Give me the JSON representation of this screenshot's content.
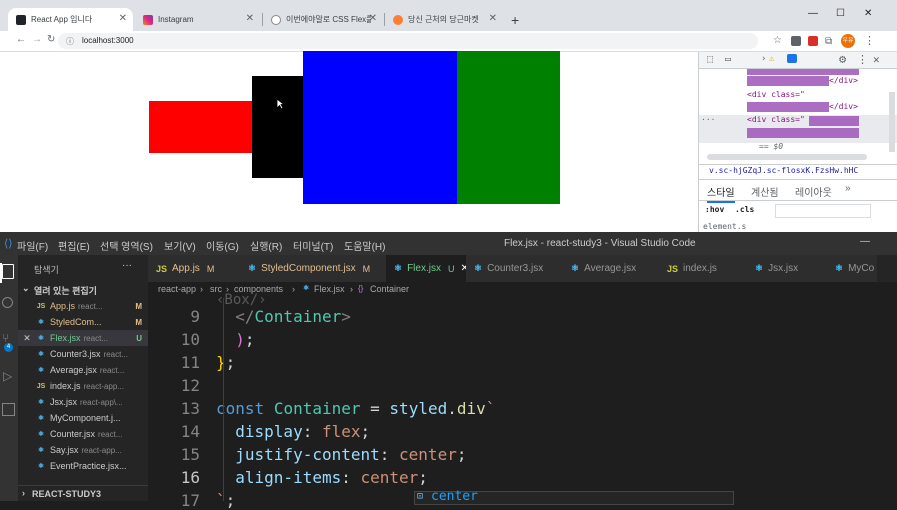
{
  "browser": {
    "tabs": [
      {
        "title": "React App 입니다",
        "active": true
      },
      {
        "title": "Instagram",
        "active": false
      },
      {
        "title": "이번에야말로 CSS Flex를 익혀보자",
        "active": false
      },
      {
        "title": "당신 근처의 당근마켓",
        "active": false
      }
    ],
    "new_tab": "+",
    "address": "localhost:3000",
    "profile": "우유"
  },
  "page": {
    "boxes": [
      {
        "color": "#ff0000"
      },
      {
        "color": "#000000"
      },
      {
        "color": "#0000ff"
      },
      {
        "color": "#008000"
      }
    ]
  },
  "devtools": {
    "lines": [
      "</div>",
      "<div class=\"",
      "</div>",
      "<div class=\"",
      "== $0"
    ],
    "selector": "v.sc-hjGZqJ.sc-flosxK.FzsHw.hHC",
    "tabs": [
      "스타일",
      "계산됨",
      "레이아웃",
      "»"
    ],
    "filter_hov": ":hov",
    "filter_cls": ".cls",
    "element_label": "element.s"
  },
  "vscode": {
    "menu": [
      "파일(F)",
      "편집(E)",
      "선택 영역(S)",
      "보기(V)",
      "이동(G)",
      "실행(R)",
      "터미널(T)",
      "도움말(H)"
    ],
    "title": "Flex.jsx - react-study3 - Visual Studio Code",
    "explorer_title": "탐색기",
    "open_editors_title": "열려 있는 편집기",
    "open_editors": [
      {
        "name": "App.js",
        "path": "react...",
        "status": "M",
        "active": false
      },
      {
        "name": "StyledCom...",
        "path": "",
        "status": "M",
        "active": false
      },
      {
        "name": "Flex.jsx",
        "path": "react...",
        "status": "U",
        "active": true
      },
      {
        "name": "Counter3.jsx",
        "path": "react...",
        "status": "",
        "active": false
      },
      {
        "name": "Average.jsx",
        "path": "react...",
        "status": "",
        "active": false
      },
      {
        "name": "index.js",
        "path": "react-app...",
        "status": "",
        "active": false
      },
      {
        "name": "Jsx.jsx",
        "path": "react-app\\...",
        "status": "",
        "active": false
      },
      {
        "name": "MyComponent.j...",
        "path": "",
        "status": "",
        "active": false
      },
      {
        "name": "Counter.jsx",
        "path": "react...",
        "status": "",
        "active": false
      },
      {
        "name": "Say.jsx",
        "path": "react-app...",
        "status": "",
        "active": false
      },
      {
        "name": "EventPractice.jsx...",
        "path": "",
        "status": "",
        "active": false
      }
    ],
    "project": "REACT-STUDY3",
    "editor_tabs": [
      {
        "name": "App.js",
        "status": "M"
      },
      {
        "name": "StyledComponent.jsx",
        "status": "M"
      },
      {
        "name": "Flex.jsx",
        "status": "U"
      },
      {
        "name": "Counter3.jsx",
        "status": ""
      },
      {
        "name": "Average.jsx",
        "status": ""
      },
      {
        "name": "index.js",
        "status": ""
      },
      {
        "name": "Jsx.jsx",
        "status": ""
      },
      {
        "name": "MyCo",
        "status": ""
      }
    ],
    "breadcrumb": [
      "react-app",
      "src",
      "components",
      "Flex.jsx",
      "Container"
    ],
    "code": [
      {
        "n": "9",
        "text": "  </Container>"
      },
      {
        "n": "10",
        "text": "  );"
      },
      {
        "n": "11",
        "text": "};"
      },
      {
        "n": "12",
        "text": ""
      },
      {
        "n": "13",
        "text": "const Container = styled.div`"
      },
      {
        "n": "14",
        "text": "  display: flex;"
      },
      {
        "n": "15",
        "text": "  justify-content: center;"
      },
      {
        "n": "16",
        "text": "  align-items: center;"
      },
      {
        "n": "17",
        "text": "`;"
      }
    ],
    "suggestion": "center",
    "badge": "4"
  }
}
